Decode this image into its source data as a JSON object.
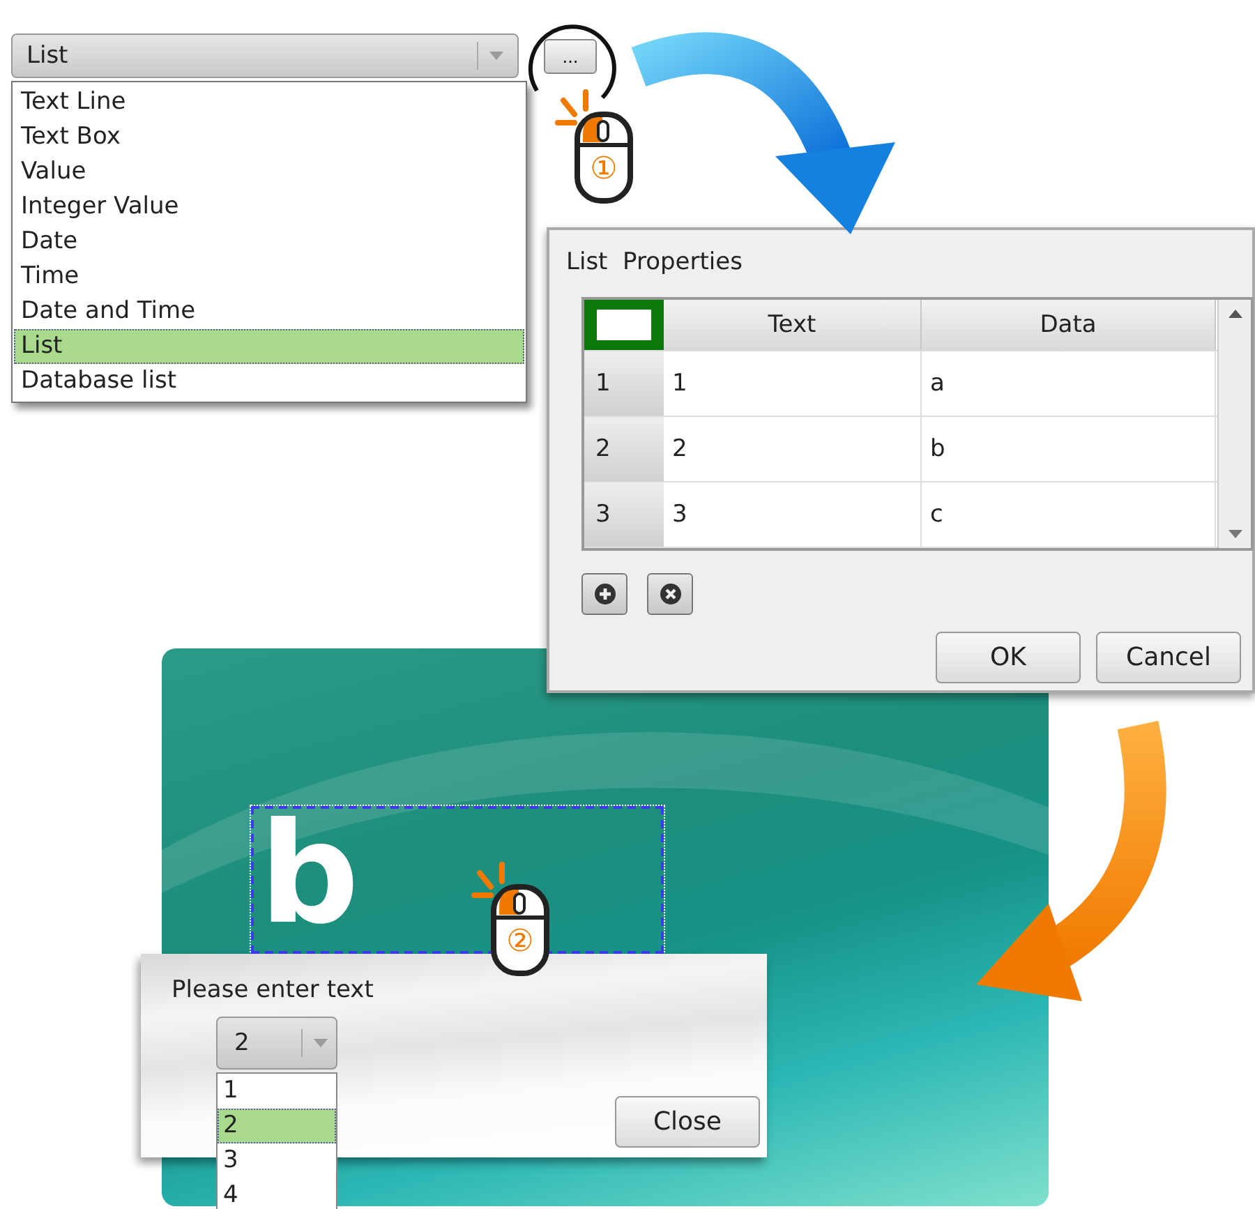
{
  "type_combo": {
    "value": "List",
    "options": [
      {
        "label": "Text Line",
        "selected": false
      },
      {
        "label": "Text Box",
        "selected": false
      },
      {
        "label": "Value",
        "selected": false
      },
      {
        "label": "Integer Value",
        "selected": false
      },
      {
        "label": "Date",
        "selected": false
      },
      {
        "label": "Time",
        "selected": false
      },
      {
        "label": "Date and Time",
        "selected": false
      },
      {
        "label": "List",
        "selected": true
      },
      {
        "label": "Database list",
        "selected": false
      }
    ]
  },
  "more_button": {
    "label": "..."
  },
  "click_markers": [
    {
      "number": "①"
    },
    {
      "number": "②"
    }
  ],
  "properties_dialog": {
    "title": "List  Properties",
    "columns": [
      "Text",
      "Data"
    ],
    "rows": [
      {
        "header": "1",
        "text": "1",
        "data": "a"
      },
      {
        "header": "2",
        "text": "2",
        "data": "b"
      },
      {
        "header": "3",
        "text": "3",
        "data": "c"
      }
    ],
    "buttons": [
      "OK",
      "Cancel"
    ]
  },
  "preview": {
    "logo": "b",
    "prompt": {
      "label": "Please enter text",
      "combo": {
        "value": "2",
        "options": [
          {
            "label": "1",
            "selected": false
          },
          {
            "label": "2",
            "selected": true
          },
          {
            "label": "3",
            "selected": false
          },
          {
            "label": "4",
            "selected": false
          }
        ]
      },
      "close": "Close"
    }
  }
}
